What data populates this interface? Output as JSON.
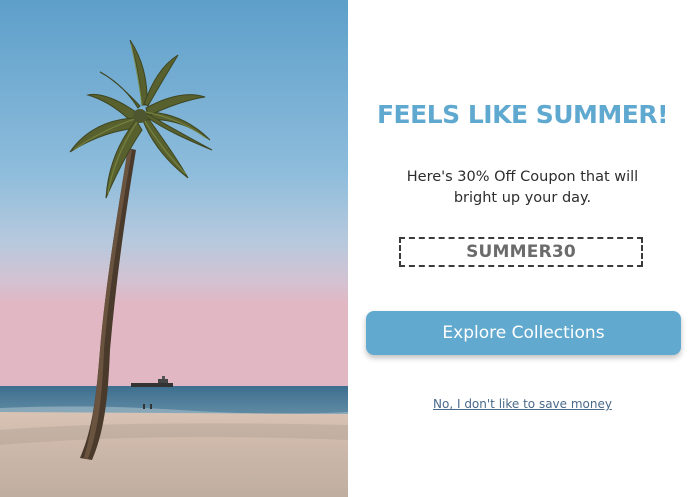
{
  "popup": {
    "headline": "FEELS LIKE SUMMER!",
    "subtext_line1": "Here's 30% Off Coupon that will",
    "subtext_line2": "bright up your day.",
    "coupon_code": "SUMMER30",
    "cta_label": "Explore Collections",
    "decline_label": "No, I don't like to save money"
  },
  "colors": {
    "accent": "#5fa8cf",
    "button": "#62a9cf"
  },
  "image": {
    "subject": "palm tree on beach at sunset"
  }
}
